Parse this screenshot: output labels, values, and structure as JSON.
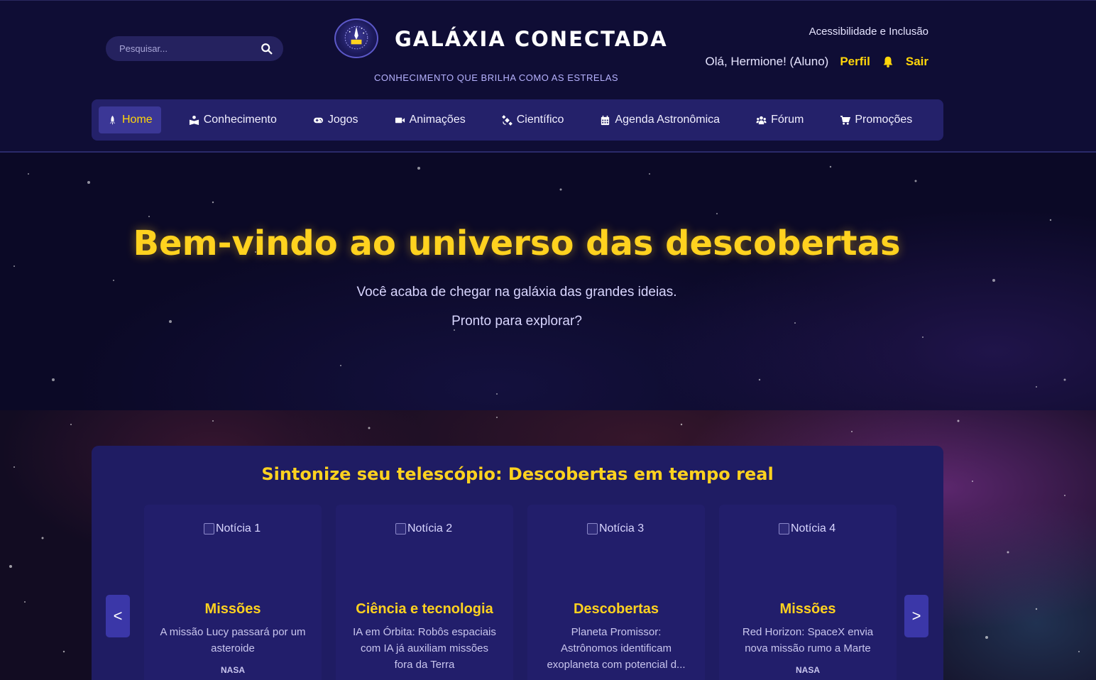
{
  "header": {
    "search_placeholder": "Pesquisar...",
    "logo_title": "GALÁXIA CONECTADA",
    "logo_tagline": "CONHECIMENTO QUE BRILHA COMO AS ESTRELAS",
    "accessibility_link": "Acessibilidade e Inclusão",
    "greeting": "Olá, Hermione! (Aluno)",
    "profile_link": "Perfil",
    "logout_link": "Sair"
  },
  "nav": {
    "items": [
      {
        "label": "Home",
        "icon": "rocket-icon",
        "active": true
      },
      {
        "label": "Conhecimento",
        "icon": "book-reader-icon"
      },
      {
        "label": "Jogos",
        "icon": "gamepad-icon"
      },
      {
        "label": "Animações",
        "icon": "video-icon"
      },
      {
        "label": "Científico",
        "icon": "satellite-icon"
      },
      {
        "label": "Agenda Astronômica",
        "icon": "calendar-icon"
      },
      {
        "label": "Fórum",
        "icon": "users-icon"
      },
      {
        "label": "Promoções",
        "icon": "cart-icon"
      }
    ]
  },
  "hero": {
    "title": "Bem-vindo ao universo das descobertas",
    "subtitle1": "Você acaba de chegar na galáxia das grandes ideias.",
    "subtitle2": "Pronto para explorar?"
  },
  "news": {
    "heading": "Sintonize seu telescópio: Descobertas em tempo real",
    "prev_label": "<",
    "next_label": ">",
    "cards": [
      {
        "image_alt": "Notícia 1",
        "category": "Missões",
        "text": "A missão Lucy passará por um asteroide",
        "source": "NASA"
      },
      {
        "image_alt": "Notícia 2",
        "category": "Ciência e tecnologia",
        "text": "IA em Órbita: Robôs espaciais com IA já auxiliam missões fora da Terra",
        "source": ""
      },
      {
        "image_alt": "Notícia 3",
        "category": "Descobertas",
        "text": "Planeta Promissor: Astrônomos identificam exoplaneta com potencial d...",
        "source": ""
      },
      {
        "image_alt": "Notícia 4",
        "category": "Missões",
        "text": "Red Horizon: SpaceX envia nova missão rumo a Marte",
        "source": "NASA"
      }
    ]
  },
  "colors": {
    "accent_yellow": "#ffd21f",
    "header_bg": "#0f0d35",
    "nav_bg": "#24216a",
    "panel_bg": "#1f1c63"
  }
}
